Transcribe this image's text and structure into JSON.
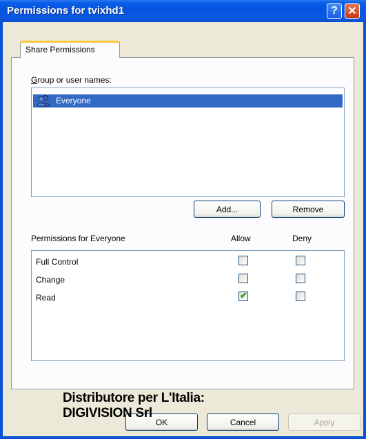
{
  "window": {
    "title": "Permissions for tvixhd1",
    "help_glyph": "?",
    "close_glyph": "✕"
  },
  "tabs": [
    {
      "label": "Share Permissions",
      "selected": true
    }
  ],
  "group_users": {
    "label": "Group or user names:",
    "items": [
      {
        "name": "Everyone",
        "icon": "users-group-icon",
        "selected": true
      }
    ]
  },
  "buttons": {
    "add": "Add...",
    "remove": "Remove",
    "ok": "OK",
    "cancel": "Cancel",
    "apply": "Apply"
  },
  "permissions": {
    "label": "Permissions for Everyone",
    "allow_header": "Allow",
    "deny_header": "Deny",
    "rows": [
      {
        "name": "Full Control",
        "allow": false,
        "deny": false
      },
      {
        "name": "Change",
        "allow": false,
        "deny": false
      },
      {
        "name": "Read",
        "allow": true,
        "deny": false
      }
    ]
  },
  "overlay_caption": {
    "line1": "Distributore per L'Italia:",
    "line2": "DIGIVISION Srl"
  },
  "colors": {
    "titlebar": "#0553df",
    "selection": "#316ac5",
    "dialog_bg": "#ece9d8",
    "check_mark": "#21a121"
  }
}
